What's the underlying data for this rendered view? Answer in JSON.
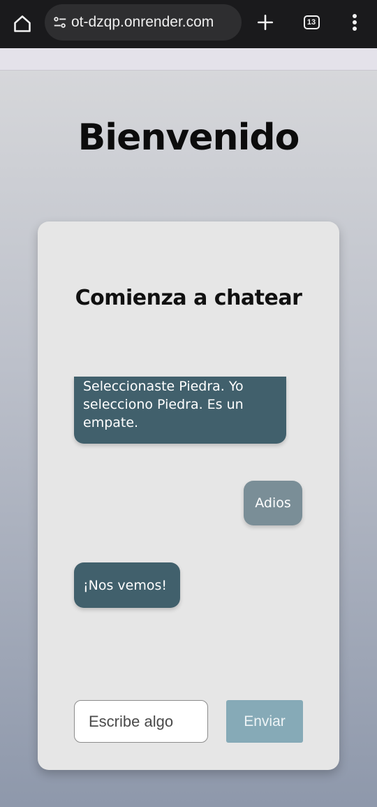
{
  "browser": {
    "url": "ot-dzqp.onrender.com",
    "tab_count": "13",
    "icons": {
      "home": "home-icon",
      "site_settings": "site-settings-icon",
      "new_tab": "plus-icon",
      "tabs": "tab-switcher-icon",
      "menu": "vertical-dots-icon"
    }
  },
  "page": {
    "title": "Bienvenido"
  },
  "chat": {
    "heading": "Comienza a chatear",
    "messages": [
      {
        "sender": "bot",
        "text": "Seleccionaste Piedra. Yo selecciono Piedra. Es un empate."
      },
      {
        "sender": "user",
        "text": "Adios"
      },
      {
        "sender": "bot",
        "text": "¡Nos vemos!"
      }
    ],
    "input": {
      "placeholder": "Escribe algo",
      "value": ""
    },
    "send_label": "Enviar"
  },
  "colors": {
    "bot_bubble": "#41606c",
    "user_bubble": "#7a8e97",
    "send_button": "#86aab7",
    "card": "#e6e6e6"
  }
}
